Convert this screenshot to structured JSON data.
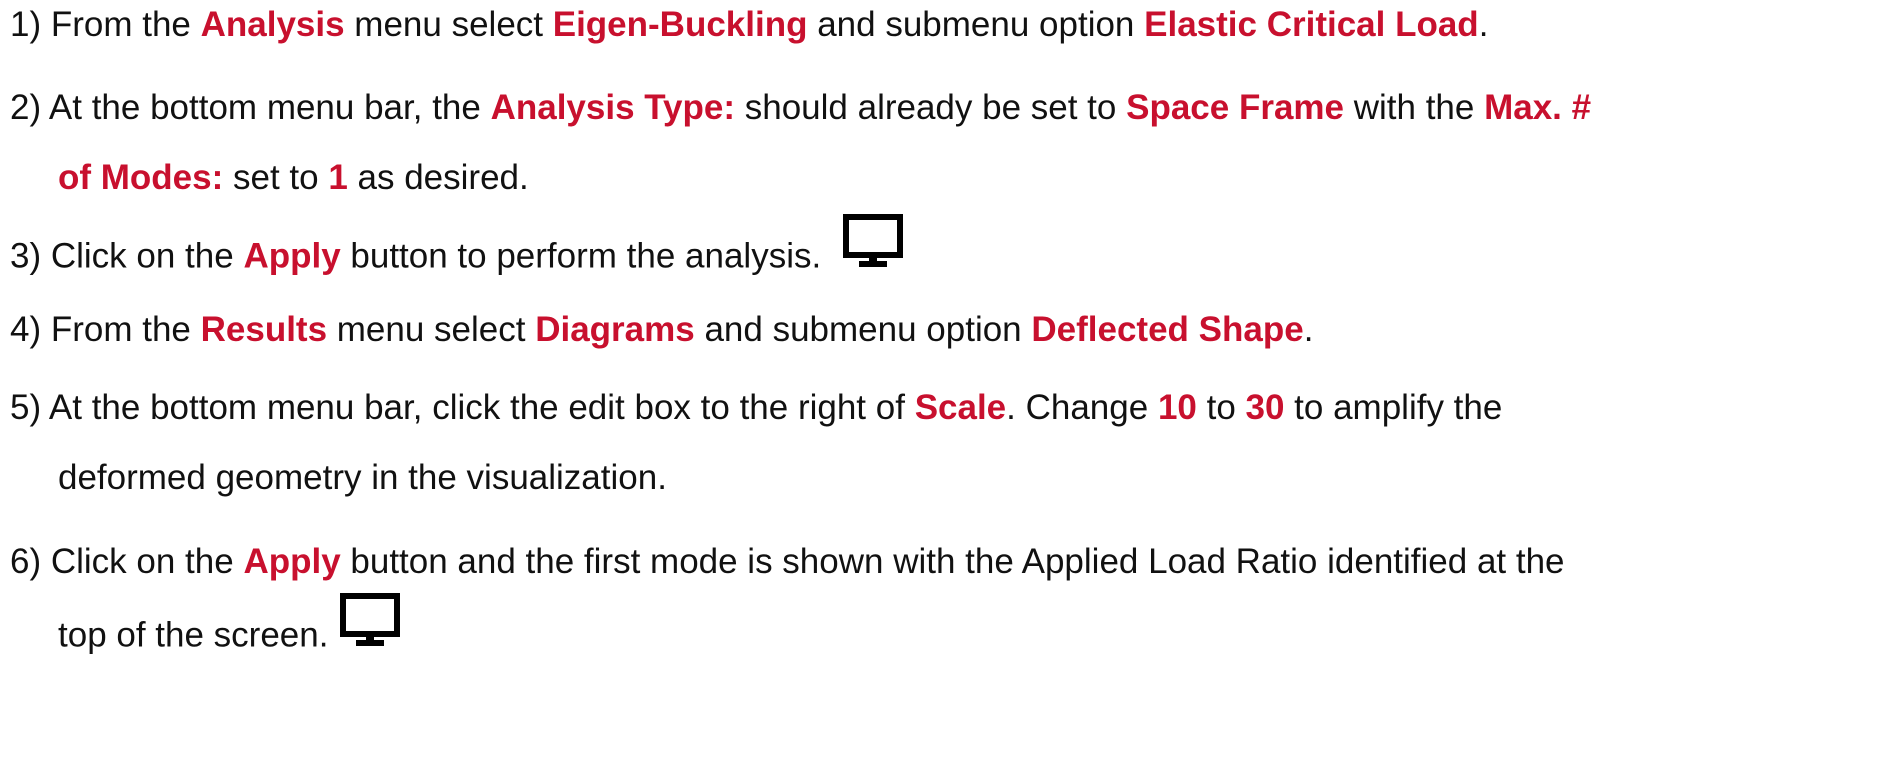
{
  "steps": [
    {
      "num": "1)",
      "parts": [
        {
          "t": " From the ",
          "h": false
        },
        {
          "t": "Analysis",
          "h": true
        },
        {
          "t": " menu select ",
          "h": false
        },
        {
          "t": "Eigen-Buckling",
          "h": true
        },
        {
          "t": " and submenu option ",
          "h": false
        },
        {
          "t": "Elastic Critical Load",
          "h": true
        },
        {
          "t": ".",
          "h": false
        }
      ]
    },
    {
      "num": "2)",
      "line1": [
        {
          "t": " At the bottom menu bar, the ",
          "h": false
        },
        {
          "t": "Analysis Type:",
          "h": true
        },
        {
          "t": " should already be set to ",
          "h": false
        },
        {
          "t": "Space Frame",
          "h": true
        },
        {
          "t": " with the ",
          "h": false
        },
        {
          "t": "Max. #",
          "h": true
        }
      ],
      "line2": [
        {
          "t": "of Modes:",
          "h": true
        },
        {
          "t": " set to ",
          "h": false
        },
        {
          "t": "1",
          "h": true
        },
        {
          "t": " as desired.",
          "h": false
        }
      ]
    },
    {
      "num": "3)",
      "parts": [
        {
          "t": " Click on the ",
          "h": false
        },
        {
          "t": "Apply",
          "h": true
        },
        {
          "t": " button to perform the analysis.",
          "h": false
        }
      ],
      "icon": "monitor-icon"
    },
    {
      "num": "4)",
      "parts": [
        {
          "t": " From the ",
          "h": false
        },
        {
          "t": "Results",
          "h": true
        },
        {
          "t": " menu select ",
          "h": false
        },
        {
          "t": "Diagrams",
          "h": true
        },
        {
          "t": " and submenu option ",
          "h": false
        },
        {
          "t": "Deflected Shape",
          "h": true
        },
        {
          "t": ".",
          "h": false
        }
      ]
    },
    {
      "num": "5)",
      "line1": [
        {
          "t": " At the bottom menu bar, click the edit box to the right of ",
          "h": false
        },
        {
          "t": "Scale",
          "h": true
        },
        {
          "t": ". Change ",
          "h": false
        },
        {
          "t": "10",
          "h": true
        },
        {
          "t": " to ",
          "h": false
        },
        {
          "t": "30",
          "h": true
        },
        {
          "t": " to amplify the",
          "h": false
        }
      ],
      "line2": [
        {
          "t": "deformed geometry in the visualization.",
          "h": false
        }
      ]
    },
    {
      "num": "6)",
      "line1": [
        {
          "t": " Click on the ",
          "h": false
        },
        {
          "t": "Apply",
          "h": true
        },
        {
          "t": " button and the first mode is shown with the Applied Load Ratio identified at the",
          "h": false
        }
      ],
      "line2": [
        {
          "t": "top of the screen.",
          "h": false
        }
      ],
      "icon": "monitor-icon"
    }
  ],
  "colors": {
    "highlight": "#c8102e",
    "text": "#111111"
  }
}
